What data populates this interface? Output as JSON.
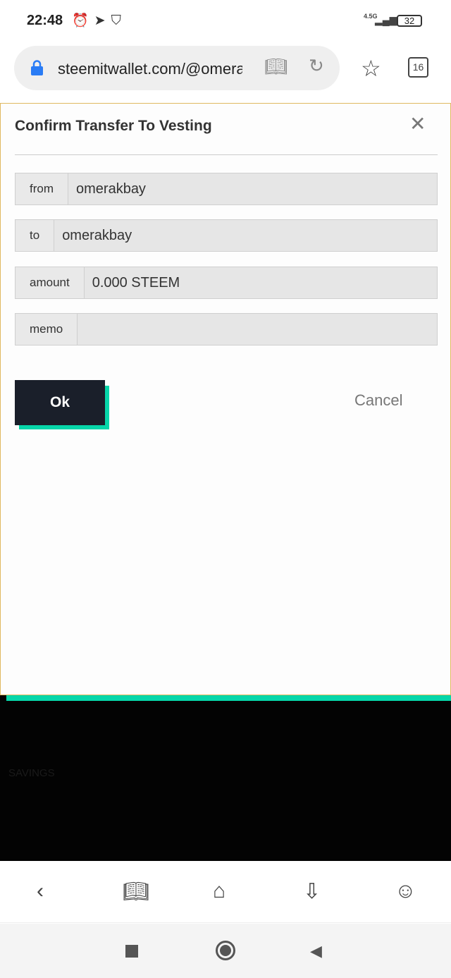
{
  "status_bar": {
    "time": "22:48",
    "icons": [
      "alarm-icon",
      "telegram-icon",
      "shield-icon"
    ],
    "network": "4.5G",
    "battery": "32"
  },
  "browser": {
    "url": "steemitwallet.com/@omerakbay",
    "tab_count": "16"
  },
  "modal": {
    "title": "Confirm Transfer To Vesting",
    "fields": [
      {
        "label": "from",
        "value": "omerakbay"
      },
      {
        "label": "to",
        "value": "omerakbay"
      },
      {
        "label": "amount",
        "value": "0.000 STEEM"
      },
      {
        "label": "memo",
        "value": ""
      }
    ],
    "ok_label": "Ok",
    "cancel_label": "Cancel"
  },
  "background": {
    "savings_heading": "SAVINGS"
  },
  "colors": {
    "accent": "#06d6a9",
    "button_dark": "#1a1f2a"
  }
}
